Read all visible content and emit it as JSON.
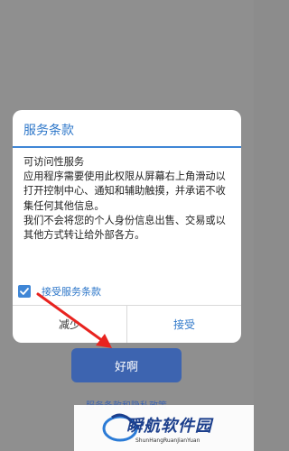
{
  "dialog": {
    "title": "服务条款",
    "body_lines": [
      "可访问性服务",
      "应用程序需要使用此权限从屏幕右上角滑动以打开控制中心、通知和辅助触摸，并承诺不收集任何其他信息。",
      "我们不会将您的个人身份信息出售、交易或以其他方式转让给外部各方。"
    ],
    "checkbox_label": "接受服务条款",
    "checkbox_checked": true,
    "btn_left": "减少",
    "btn_right": "接受"
  },
  "primary_button": "好啊",
  "policy_link": "服务条款和隐私政策",
  "watermark": {
    "title": "瞬航软件园",
    "subtitle": "ShunHangRuanJianYuan"
  },
  "colors": {
    "accent": "#3f86d6",
    "primary_button": "#3d64b0",
    "overlay": "#8f8f8f",
    "arrow": "#e8231f"
  }
}
